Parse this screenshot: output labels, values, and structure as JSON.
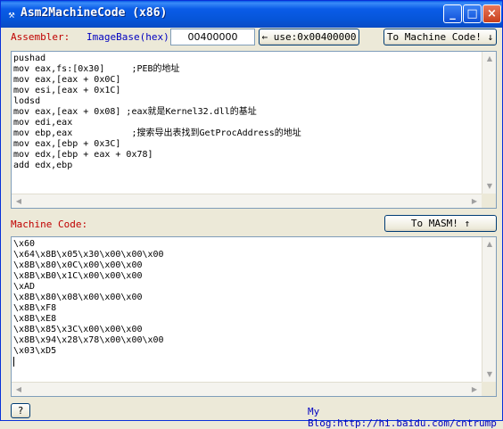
{
  "window": {
    "title": "Asm2MachineCode (x86)",
    "icon": "hammer-icon",
    "min_glyph": "_",
    "max_glyph": "□",
    "close_glyph": "×"
  },
  "assembler": {
    "label": "Assembler:",
    "imagebase_label": "ImageBase(hex):",
    "imagebase_value": "00400000",
    "use_button": "← use:0x00400000",
    "to_machine_button": "To Machine Code! ↓",
    "code": "pushad\nmov eax,fs:[0x30]     ;PEB的地址\nmov eax,[eax + 0x0C]\nmov esi,[eax + 0x1C]\nlodsd\nmov eax,[eax + 0x08] ;eax就是Kernel32.dll的基址\nmov edi,eax\nmov ebp,eax           ;搜索导出表找到GetProcAddress的地址\nmov eax,[ebp + 0x3C]\nmov edx,[ebp + eax + 0x78]\nadd edx,ebp"
  },
  "machine": {
    "label": "Machine Code:",
    "to_masm_button": "To MASM! ↑",
    "code": "\\x60\n\\x64\\x8B\\x05\\x30\\x00\\x00\\x00\n\\x8B\\x80\\x0C\\x00\\x00\\x00\n\\x8B\\xB0\\x1C\\x00\\x00\\x00\n\\xAD\n\\x8B\\x80\\x08\\x00\\x00\\x00\n\\x8B\\xF8\n\\x8B\\xE8\n\\x8B\\x85\\x3C\\x00\\x00\\x00\n\\x8B\\x94\\x28\\x78\\x00\\x00\\x00\n\\x03\\xD5"
  },
  "footer": {
    "help_button": "?",
    "blog_link": "My Blog:http://hi.baidu.com/cntrump"
  },
  "scroll_arrows": {
    "up": "▲",
    "down": "▼",
    "left": "◀",
    "right": "▶"
  },
  "colors": {
    "title_bar": "#0a5ce8",
    "label_red": "#c00000",
    "label_blue": "#0000c0",
    "window_bg": "#ece9d8"
  }
}
